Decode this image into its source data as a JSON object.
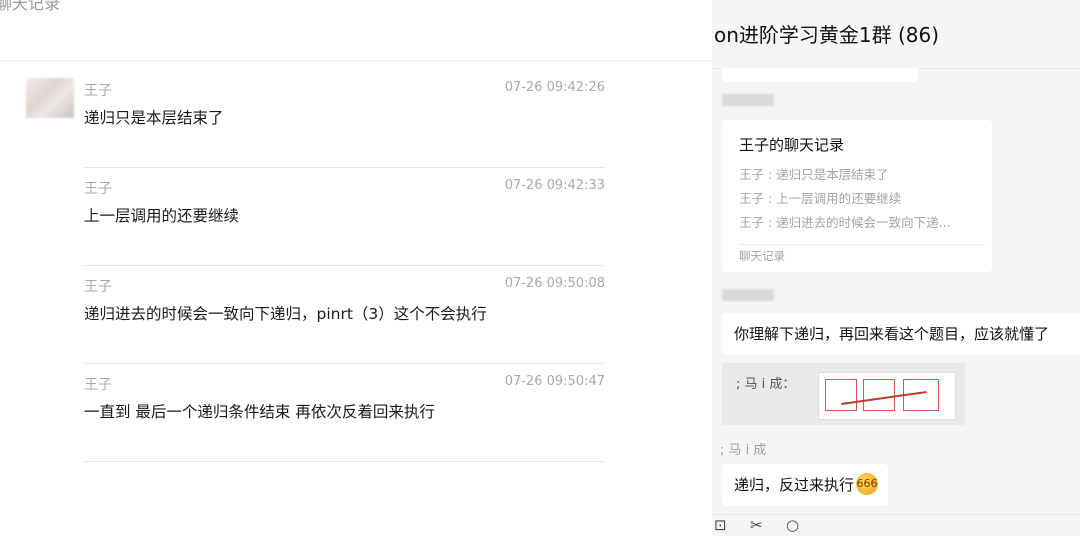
{
  "record_window": {
    "title_fragment": "聊天记录",
    "messages": [
      {
        "sender": "王子",
        "time": "07-26 09:42:26",
        "text": "递归只是本层结束了"
      },
      {
        "sender": "王子",
        "time": "07-26 09:42:33",
        "text": "上一层调用的还要继续"
      },
      {
        "sender": "王子",
        "time": "07-26 09:50:08",
        "text": "递归进去的时候会一致向下递归，pinrt（3）这个不会执行"
      },
      {
        "sender": "王子",
        "time": "07-26 09:50:47",
        "text": "一直到 最后一个递归条件结束  再依次反着回来执行"
      }
    ]
  },
  "group_chat": {
    "title": "on进阶学习黄金1群 (86)",
    "record_card": {
      "title": "王子的聊天记录",
      "lines": [
        "王子 : 递归只是本层结束了",
        "王子 : 上一层调用的还要继续",
        "王子 : 递归进去的时候会一致向下递..."
      ],
      "footer": "聊天记录"
    },
    "bubble_1": "你理解下递归，再回来看这个题目，应该就懂了",
    "image_msg_caption": "; 马 i  成：",
    "sender_label": "; 马 i  成",
    "bubble_2": "递归，反过来执行",
    "emoji_label": "666",
    "toolbar": {
      "icon_1": "⊡",
      "icon_2": "✂",
      "icon_3": "○"
    }
  }
}
